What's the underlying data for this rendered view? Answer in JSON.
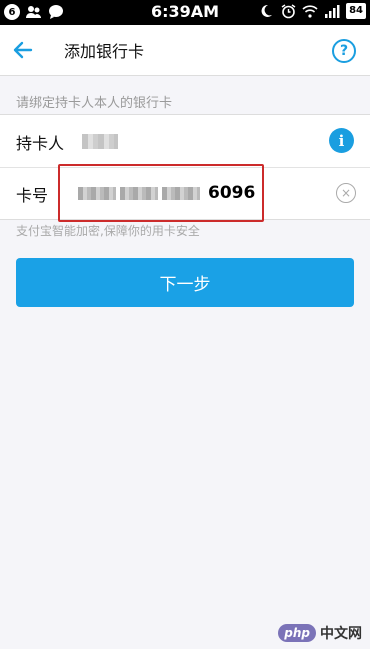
{
  "status_bar": {
    "notification_count": "6",
    "time": "6:39AM",
    "battery": "84"
  },
  "nav": {
    "title": "添加银行卡",
    "help_glyph": "?"
  },
  "form": {
    "hint": "请绑定持卡人本人的银行卡",
    "holder_label": "持卡人",
    "info_glyph": "i",
    "card_label": "卡号",
    "card_number_visible_tail": "6096",
    "clear_glyph": "×",
    "security_note": "支付宝智能加密,保障你的用卡安全"
  },
  "next_button_label": "下一步",
  "watermark": {
    "brand": "php",
    "site": "中文网"
  },
  "colors": {
    "accent": "#1a9ee0",
    "button": "#1aa1e6",
    "highlight": "#cc2b2b",
    "page_bg": "#f5f5f9"
  }
}
